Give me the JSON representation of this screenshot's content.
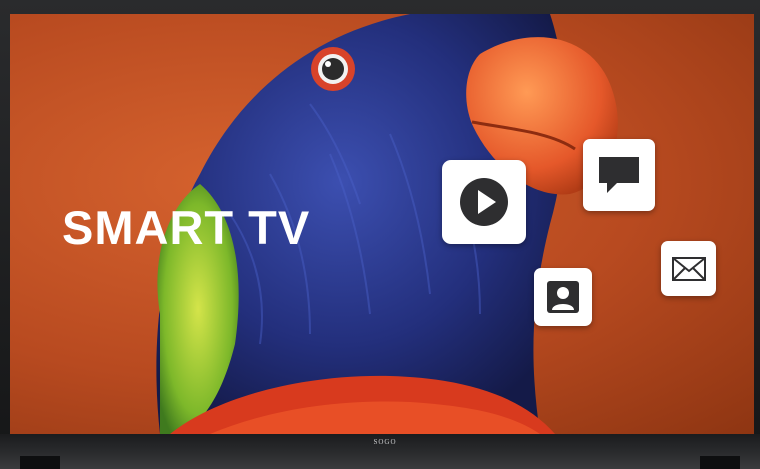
{
  "brand": {
    "logo_text": "SOGO"
  },
  "screen": {
    "headline": "SMART TV",
    "background_color": "#c4522a",
    "app_icons": [
      {
        "name": "play-icon"
      },
      {
        "name": "chat-icon"
      },
      {
        "name": "user-icon"
      },
      {
        "name": "mail-icon"
      }
    ]
  },
  "colors": {
    "icon_dark": "#2e2e30",
    "tile_bg": "#ffffff",
    "frame": "#1c1d1f"
  }
}
